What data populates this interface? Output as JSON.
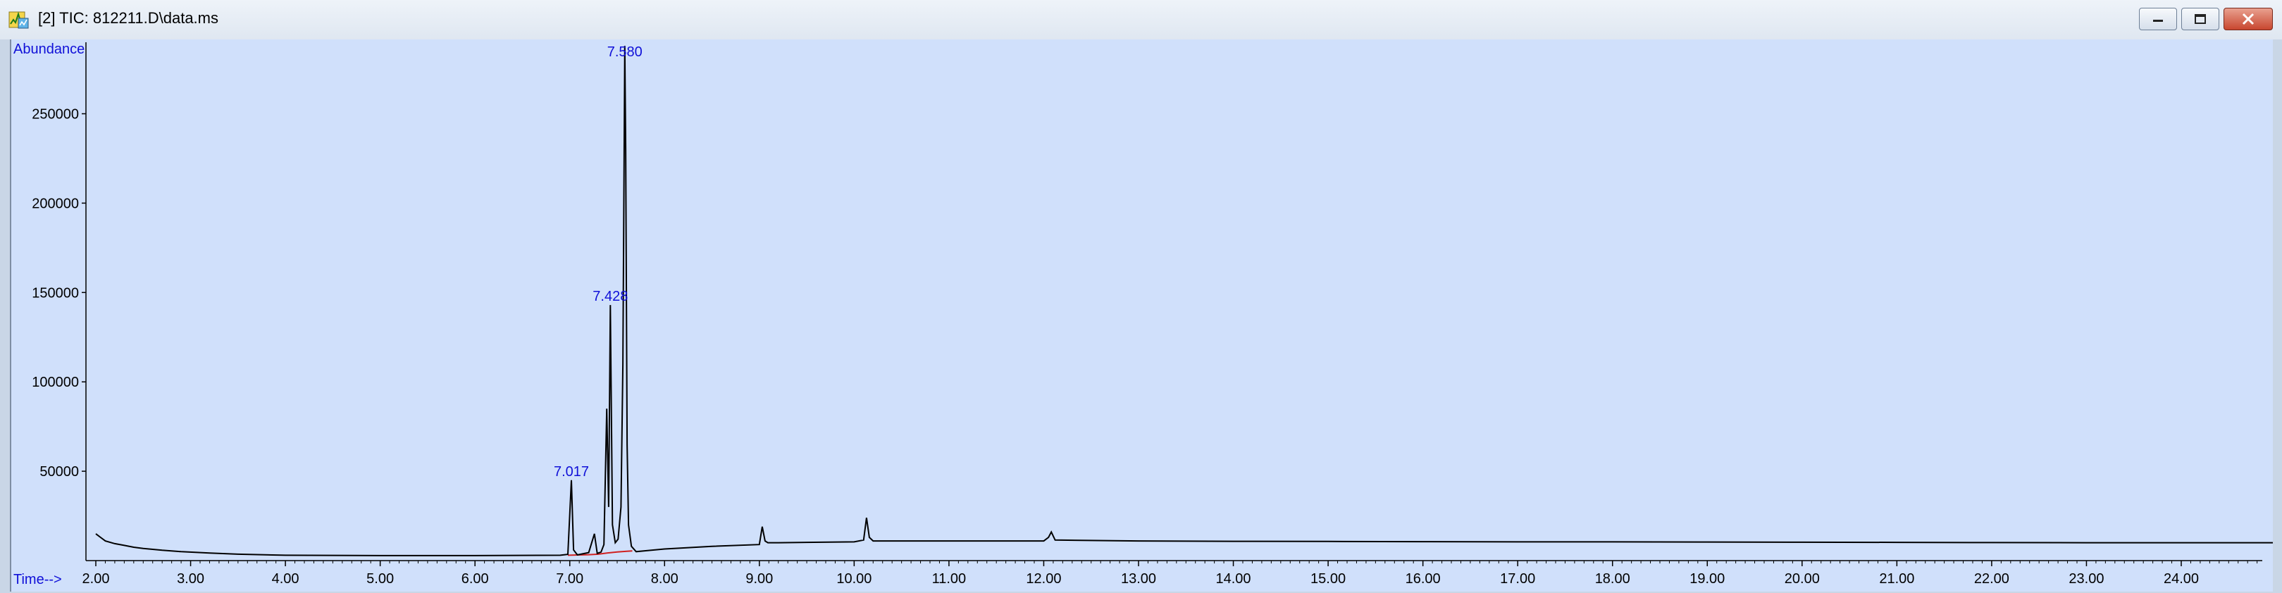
{
  "window": {
    "title": "[2] TIC: 812211.D\\data.ms",
    "icon": "chromatogram-app-icon",
    "buttons": [
      "minimize-icon",
      "restore-icon",
      "close-icon"
    ]
  },
  "chart_data": {
    "type": "line",
    "ylabel": "Abundance",
    "xlabel": "Time-->",
    "xlim": [
      1.9,
      25.2
    ],
    "ylim": [
      0,
      290000
    ],
    "x_ticks": [
      "2.00",
      "3.00",
      "4.00",
      "5.00",
      "6.00",
      "7.00",
      "8.00",
      "9.00",
      "10.00",
      "11.00",
      "12.00",
      "13.00",
      "14.00",
      "15.00",
      "16.00",
      "17.00",
      "18.00",
      "19.00",
      "20.00",
      "21.00",
      "22.00",
      "23.00",
      "24.00"
    ],
    "y_ticks": [
      "50000",
      "100000",
      "150000",
      "200000",
      "250000"
    ],
    "series": [
      {
        "x": [
          2.0,
          2.05,
          2.1,
          2.2,
          2.3,
          2.4,
          2.5,
          2.7,
          2.9,
          3.2,
          3.5,
          4.0,
          5.0,
          6.0,
          6.9,
          6.98,
          7.017,
          7.04,
          7.08,
          7.2,
          7.26,
          7.29,
          7.33,
          7.36,
          7.39,
          7.41,
          7.428,
          7.45,
          7.48,
          7.51,
          7.54,
          7.56,
          7.58,
          7.59,
          7.605,
          7.62,
          7.65,
          7.7,
          7.8,
          8.0,
          8.5,
          9.0,
          9.03,
          9.06,
          9.09,
          9.2,
          10.0,
          10.1,
          10.13,
          10.16,
          10.2,
          11.0,
          12.0,
          12.05,
          12.08,
          12.12,
          13.0,
          14.0,
          15.0,
          16.0,
          17.0,
          18.0,
          19.0,
          20.0,
          21.0,
          22.0,
          23.0,
          24.0,
          25.1
        ],
        "y": [
          15000,
          13000,
          11000,
          9500,
          8500,
          7500,
          6800,
          5800,
          5000,
          4200,
          3600,
          3000,
          2800,
          2800,
          3000,
          3500,
          45000,
          6000,
          3200,
          4500,
          15000,
          4000,
          4800,
          9000,
          85000,
          30000,
          143000,
          20000,
          10000,
          12000,
          30000,
          110000,
          288000,
          230000,
          65000,
          20000,
          8000,
          5000,
          5500,
          6500,
          8000,
          9000,
          19000,
          11000,
          10000,
          10000,
          10500,
          11500,
          24000,
          13000,
          11000,
          11000,
          11000,
          13000,
          16000,
          11500,
          11000,
          10800,
          10700,
          10600,
          10500,
          10500,
          10400,
          10300,
          10200,
          10100,
          10000,
          10000,
          10000
        ],
        "color": "#000000"
      }
    ],
    "baseline": {
      "x": [
        6.98,
        7.05,
        7.2,
        7.3,
        7.4,
        7.5,
        7.6,
        7.66
      ],
      "y": [
        3000,
        3100,
        3300,
        3600,
        4300,
        4800,
        5200,
        5400
      ],
      "color": "#d02020"
    },
    "peak_labels": [
      {
        "x": 7.017,
        "y": 45000,
        "text": "7.017"
      },
      {
        "x": 7.428,
        "y": 143000,
        "text": "7.428"
      },
      {
        "x": 7.58,
        "y": 288000,
        "text": "7.580"
      }
    ],
    "grid": false,
    "label_color": "#1010d8"
  }
}
